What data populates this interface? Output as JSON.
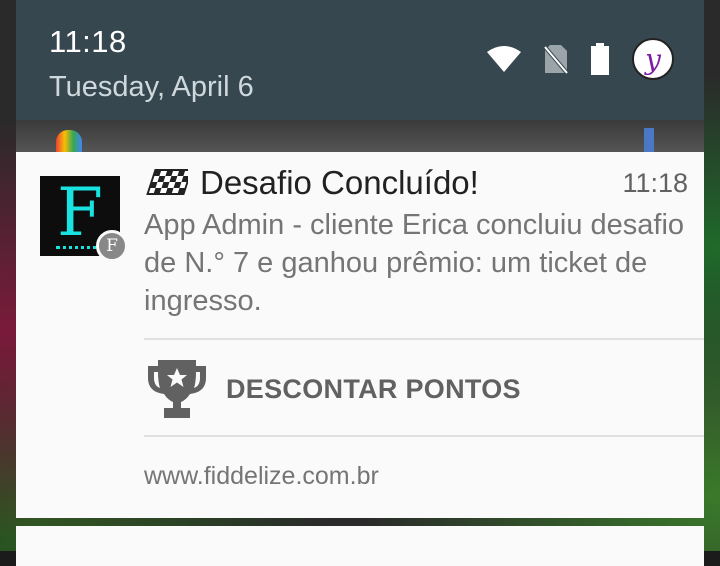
{
  "status_bar": {
    "time": "11:18",
    "date": "Tuesday, April 6",
    "avatar_letter": "y",
    "icons": [
      "wifi-icon",
      "no-sim-icon",
      "battery-icon"
    ]
  },
  "notification": {
    "app_icon_letter": "F",
    "badge_letter": "F",
    "title_icon": "checkered-flag-icon",
    "title": "Desafio Concluído!",
    "time": "11:18",
    "body": "App Admin - cliente Erica concluiu desafio de N.° 7 e ganhou prêmio: um ticket de ingresso.",
    "action": {
      "icon": "trophy-icon",
      "label": "DESCONTAR PONTOS"
    },
    "footer": "www.fiddelize.com.br"
  },
  "colors": {
    "panel": "#37474f",
    "card": "#fafafa",
    "accent": "#19e3e0"
  }
}
